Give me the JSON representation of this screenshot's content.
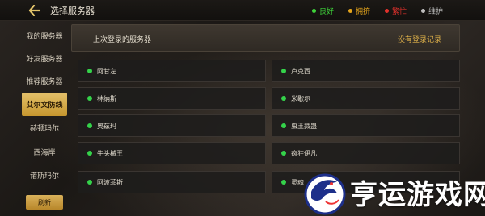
{
  "header": {
    "title": "选择服务器",
    "legend": [
      {
        "label": "良好",
        "color": "#3ed23a"
      },
      {
        "label": "拥挤",
        "color": "#e5a51c"
      },
      {
        "label": "繁忙",
        "color": "#e2312c"
      },
      {
        "label": "维护",
        "color": "#bdbdbd"
      }
    ]
  },
  "sidebar": {
    "items": [
      {
        "label": "我的服务器"
      },
      {
        "label": "好友服务器"
      },
      {
        "label": "推荐服务器"
      },
      {
        "label": "艾尔文防线",
        "active": true
      },
      {
        "label": "赫顿玛尔"
      },
      {
        "label": "西海岸"
      },
      {
        "label": "诺斯玛尔"
      }
    ],
    "refresh_label": "刷新"
  },
  "last_login": {
    "title": "上次登录的服务器",
    "record_text": "没有登录记录"
  },
  "servers": [
    {
      "name": "阿甘左",
      "status_color": "#34d24a"
    },
    {
      "name": "卢克西",
      "status_color": "#34d24a"
    },
    {
      "name": "林纳斯",
      "status_color": "#34d24a"
    },
    {
      "name": "米歇尔",
      "status_color": "#34d24a"
    },
    {
      "name": "奥兹玛",
      "status_color": "#34d24a"
    },
    {
      "name": "虫王戮蛊",
      "status_color": "#34d24a"
    },
    {
      "name": "牛头械王",
      "status_color": "#34d24a"
    },
    {
      "name": "疯狂伊凡",
      "status_color": "#34d24a"
    },
    {
      "name": "阿波菲斯",
      "status_color": "#34d24a"
    },
    {
      "name": "灵魂",
      "status_color": "#34d24a"
    }
  ],
  "watermark": {
    "text": "亨运游戏网"
  }
}
